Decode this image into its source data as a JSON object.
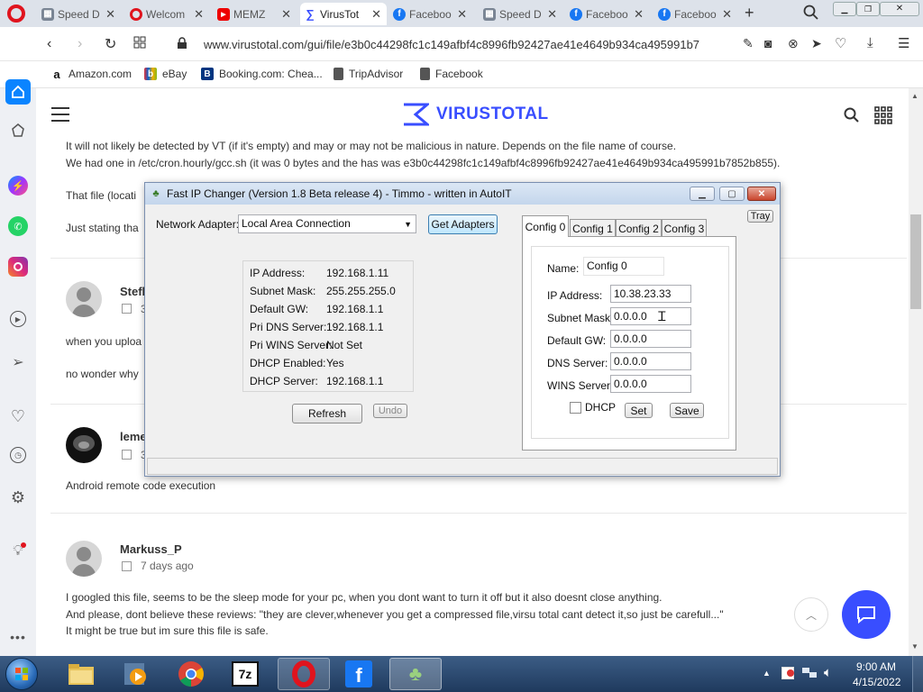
{
  "browser": {
    "tabs": [
      {
        "label": "Speed D",
        "icon": "grid-icon"
      },
      {
        "label": "Welcom",
        "icon": "opera-icon"
      },
      {
        "label": "MEMZ",
        "icon": "youtube-icon"
      },
      {
        "label": "VirusTot",
        "icon": "virustotal-icon"
      },
      {
        "label": "Faceboo",
        "icon": "facebook-icon"
      },
      {
        "label": "Speed D",
        "icon": "grid-icon"
      },
      {
        "label": "Faceboo",
        "icon": "facebook-icon"
      },
      {
        "label": "Faceboo",
        "icon": "facebook-icon"
      }
    ],
    "url": "www.virustotal.com/gui/file/e3b0c44298fc1c149afbf4c8996fb92427ae41e4649b934ca495991b7",
    "bookmarks": [
      {
        "label": "Amazon.com",
        "icon": "amazon-icon"
      },
      {
        "label": "eBay",
        "icon": "ebay-icon"
      },
      {
        "label": "Booking.com: Chea...",
        "icon": "booking-icon"
      },
      {
        "label": "TripAdvisor",
        "icon": "page-icon"
      },
      {
        "label": "Facebook",
        "icon": "page-icon"
      }
    ]
  },
  "site": {
    "brand": "VIRUSTOTAL",
    "brand_color": "#394eff"
  },
  "comments": {
    "line1": "It will not likely be detected by VT (if it's empty) and may or may not be malicious in nature. Depends on the file name of course.",
    "line2": "We had one in /etc/cron.hourly/gcc.sh (it was 0 bytes and the has was e3b0c44298fc1c149afbf4c8996fb92427ae41e4649b934ca495991b7852b855).",
    "line3": "That file (locati",
    "line4": "Just stating tha",
    "user2": "Stefl",
    "user2_date": "3",
    "line5": "when you uploa",
    "line6": "no wonder why",
    "user3": "leme",
    "user3_date": "3",
    "line7": "Android remote code execution",
    "user4": "Markuss_P",
    "user4_date": "7 days ago",
    "line8": "I googled this file, seems to be the sleep mode for your pc, when you dont want to turn it off but it also doesnt close anything.",
    "line9": "And please, dont believe these reviews: \"they are clever,whenever you get a compressed file,virsu total cant detect it,so just be carefull...\"",
    "line10": "It might be true but im sure this file is safe."
  },
  "dialog": {
    "title": "Fast IP Changer (Version 1.8 Beta release 4) - Timmo - written in AutoIT",
    "adapter_label": "Network Adapter:",
    "adapter_value": "Local Area Connection",
    "get_adapters": "Get Adapters",
    "tray": "Tray",
    "info": [
      {
        "k": "IP Address:",
        "v": "192.168.1.11"
      },
      {
        "k": "Subnet Mask:",
        "v": "255.255.255.0"
      },
      {
        "k": "Default GW:",
        "v": "192.168.1.1"
      },
      {
        "k": "Pri DNS Server:",
        "v": "192.168.1.1"
      },
      {
        "k": "Pri WINS Server:",
        "v": "Not Set"
      },
      {
        "k": "DHCP Enabled:",
        "v": "Yes"
      },
      {
        "k": "DHCP Server:",
        "v": "192.168.1.1"
      }
    ],
    "refresh": "Refresh",
    "undo": "Undo",
    "tabs": [
      "Config 0",
      "Config 1",
      "Config 2",
      "Config 3"
    ],
    "config": {
      "name_label": "Name:",
      "name_value": "Config 0",
      "fields": [
        {
          "k": "IP Address:",
          "v": "10.38.23.33"
        },
        {
          "k": "Subnet Mask:",
          "v": "0.0.0.0"
        },
        {
          "k": "Default GW:",
          "v": "0.0.0.0"
        },
        {
          "k": "DNS Server:",
          "v": "0.0.0.0"
        },
        {
          "k": "WINS Server:",
          "v": "0.0.0.0"
        }
      ],
      "dhcp_label": "DHCP",
      "set": "Set",
      "save": "Save"
    }
  },
  "taskbar": {
    "time": "9:00 AM",
    "date": "4/15/2022"
  }
}
